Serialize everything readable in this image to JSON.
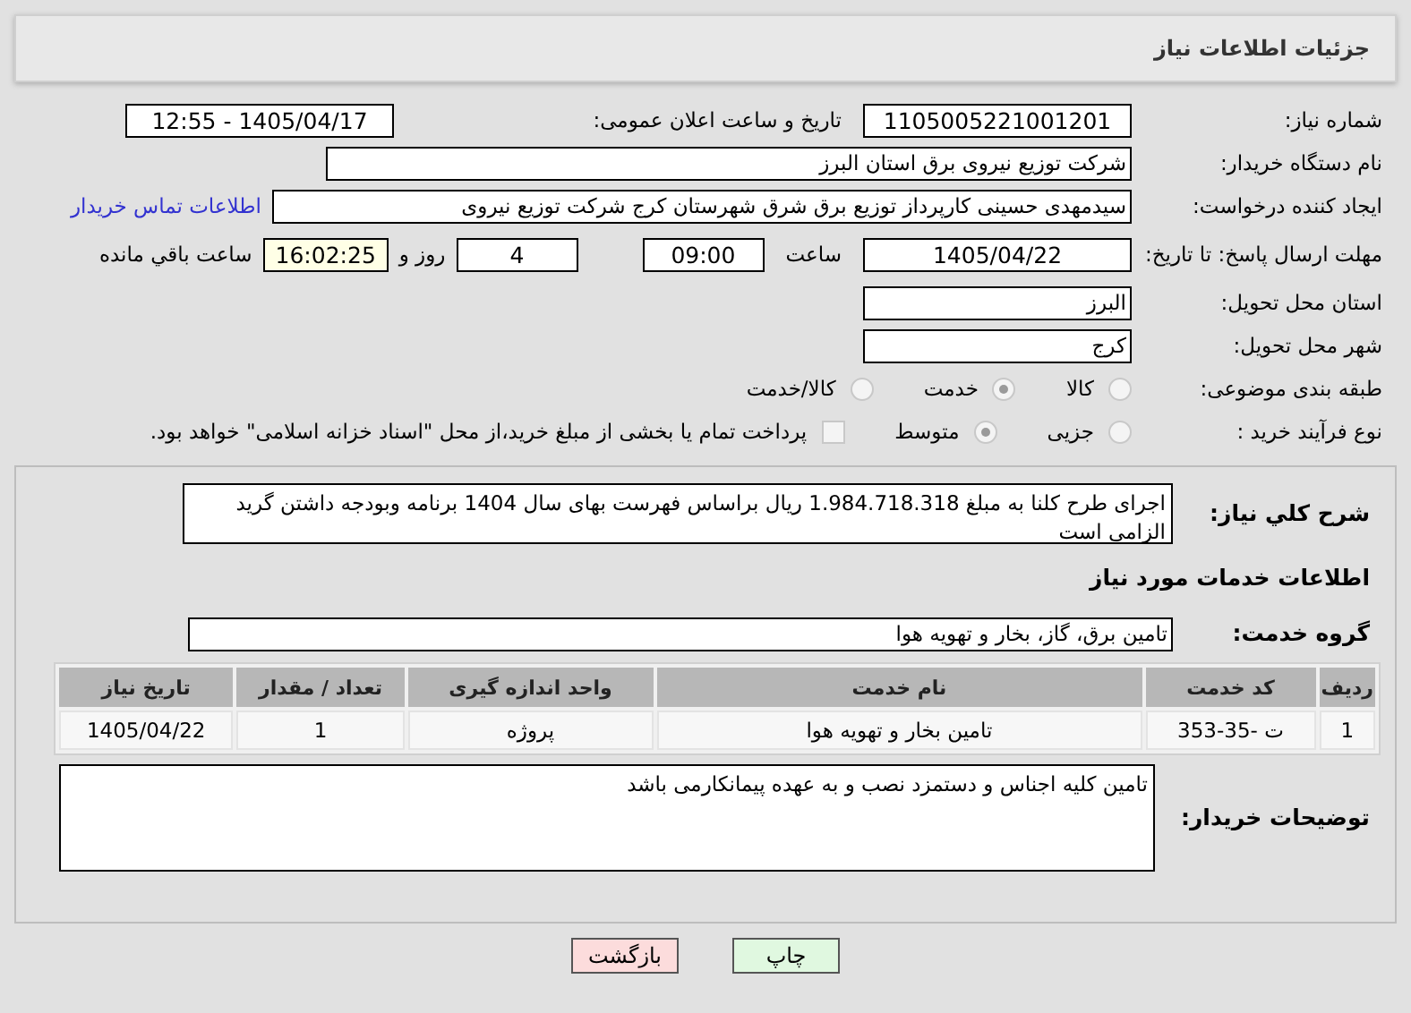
{
  "header": {
    "title": "جزئیات اطلاعات نیاز"
  },
  "need_number": {
    "label": "شماره نیاز:",
    "value": "1105005221001201"
  },
  "announce": {
    "label": "تاریخ و ساعت اعلان عمومی:",
    "value": "1405/04/17 - 12:55"
  },
  "buyer": {
    "label": "نام دستگاه خریدار:",
    "value": "شرکت توزیع نیروی برق استان البرز"
  },
  "requester": {
    "label": "ایجاد کننده درخواست:",
    "value": "سیدمهدی حسینی کارپرداز توزیع برق شرق شهرستان کرج شرکت توزیع نیروی",
    "link": "اطلاعات تماس خریدار"
  },
  "deadline": {
    "label": "مهلت ارسال پاسخ: تا تاریخ:",
    "date": "1405/04/22",
    "time_label": "ساعت",
    "time": "09:00",
    "days": "4",
    "days_label": "روز و",
    "remaining": "16:02:25",
    "remaining_label": "ساعت باقي مانده"
  },
  "province": {
    "label": "استان محل تحویل:",
    "value": "البرز"
  },
  "city": {
    "label": "شهر محل تحویل:",
    "value": "کرج"
  },
  "category": {
    "label": "طبقه بندی موضوعی:",
    "options": [
      {
        "label": "کالا",
        "selected": false
      },
      {
        "label": "خدمت",
        "selected": true
      },
      {
        "label": "کالا/خدمت",
        "selected": false
      }
    ]
  },
  "purchase_type": {
    "label": "نوع فرآیند خرید :",
    "options": [
      {
        "label": "جزیی",
        "selected": false
      },
      {
        "label": "متوسط",
        "selected": true
      }
    ],
    "treasury": {
      "checked": false,
      "text": "پرداخت تمام یا بخشی از مبلغ خرید،از محل \"اسناد خزانه اسلامی\" خواهد بود."
    }
  },
  "summary": {
    "label": "شرح کلي نياز:",
    "value": "اجرای طرح کلنا به مبلغ 1.984.718.318 ریال براساس فهرست بهای سال 1404 برنامه وبودجه داشتن گرید الزامی است"
  },
  "services_heading": "اطلاعات خدمات مورد نیاز",
  "service_group": {
    "label": "گروه خدمت:",
    "value": "تامین برق، گاز، بخار و تهویه هوا"
  },
  "table": {
    "columns": [
      "ردیف",
      "کد خدمت",
      "نام خدمت",
      "واحد اندازه گیری",
      "تعداد / مقدار",
      "تاریخ نیاز"
    ],
    "rows": [
      [
        "1",
        "ت -35-353",
        "تامین بخار و تهویه هوا",
        "پروژه",
        "1",
        "1405/04/22"
      ]
    ]
  },
  "buyer_notes": {
    "label": "توضیحات خریدار:",
    "value": "تامین کلیه اجناس و دستمزد نصب و به عهده پیمانکارمی باشد"
  },
  "buttons": [
    {
      "label": "چاپ",
      "kind": "print"
    },
    {
      "label": "بازگشت",
      "kind": "back"
    }
  ]
}
